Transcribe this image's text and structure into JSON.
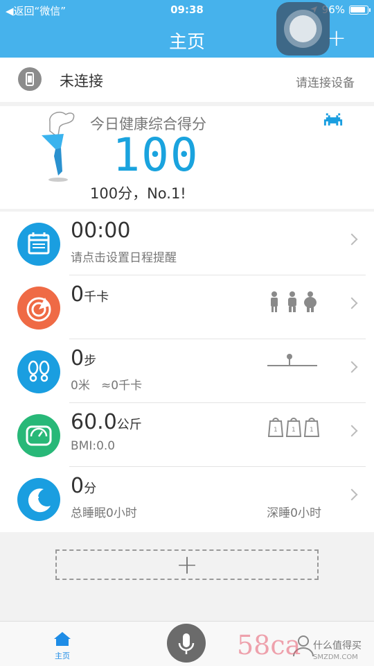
{
  "status_bar": {
    "back_label": "◀返回“微信”",
    "time": "09:38",
    "battery": "96%"
  },
  "nav": {
    "title": "主页",
    "add_label": "+"
  },
  "device": {
    "name": "未连接",
    "action": "请连接设备"
  },
  "score": {
    "title": "今日健康综合得分",
    "value": "100",
    "subtitle": "100分，No.1!"
  },
  "rows": [
    {
      "value": "00:00",
      "unit": "",
      "sub": "请点击设置日程提醒",
      "right": "",
      "icon": "calendar-icon",
      "color": "#1a9ee0"
    },
    {
      "value": "0",
      "unit": "千卡",
      "sub": "",
      "right": "",
      "icon": "calorie-icon",
      "color": "#ef6a45"
    },
    {
      "value": "0",
      "unit": "步",
      "sub": "0米   ≈0千卡",
      "right": "",
      "icon": "footsteps-icon",
      "color": "#1a9ee0"
    },
    {
      "value": "60.0",
      "unit": "公斤",
      "sub": "BMI:0.0",
      "right": "",
      "icon": "scale-icon",
      "color": "#28b878"
    },
    {
      "value": "0",
      "unit": "分",
      "sub": "总睡眠0小时",
      "right": "深睡0小时",
      "icon": "moon-icon",
      "color": "#1a9ee0"
    }
  ],
  "add_card": {
    "label": "+"
  },
  "tabbar": {
    "home_label": "主页"
  },
  "watermark": {
    "main": "58ca",
    "line1": "什么值得买",
    "line2": "SMZDM.COM"
  }
}
